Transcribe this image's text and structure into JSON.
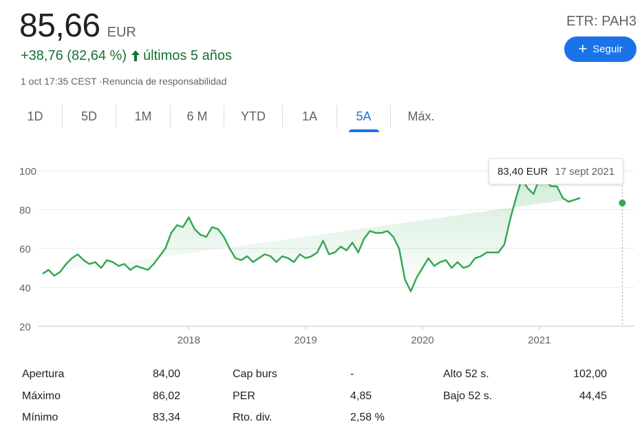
{
  "header": {
    "price": "85,66",
    "currency": "EUR",
    "change": "+38,76 (82,64 %)",
    "change_period": "últimos 5 años",
    "meta": "1 oct 17:35 CEST ·Renuncia de responsabilidad",
    "ticker": "ETR: PAH3",
    "follow_label": "Seguir"
  },
  "tabs": [
    {
      "label": "1D"
    },
    {
      "label": "5D"
    },
    {
      "label": "1M"
    },
    {
      "label": "6 M"
    },
    {
      "label": "YTD"
    },
    {
      "label": "1A"
    },
    {
      "label": "5A"
    },
    {
      "label": "Máx."
    }
  ],
  "active_tab": "5A",
  "tooltip": {
    "value": "83,40 EUR",
    "date": "17 sept 2021"
  },
  "stats": [
    {
      "label": "Apertura",
      "value": "84,00"
    },
    {
      "label": "Máximo",
      "value": "86,02"
    },
    {
      "label": "Mínimo",
      "value": "83,34"
    },
    {
      "label": "Cap burs",
      "value": "-"
    },
    {
      "label": "PER",
      "value": "4,85"
    },
    {
      "label": "Rto. div.",
      "value": "2,58 %"
    },
    {
      "label": "Alto 52 s.",
      "value": "102,00"
    },
    {
      "label": "Bajo 52 s.",
      "value": "44,45"
    }
  ],
  "colors": {
    "line": "#34a853",
    "accent": "#1a73e8",
    "positive": "#137333"
  },
  "chart_data": {
    "type": "area",
    "ylim": [
      20,
      100
    ],
    "y_ticks": [
      100,
      80,
      60,
      40,
      20
    ],
    "x_ticks": [
      "2018",
      "2019",
      "2020",
      "2021"
    ],
    "x_tick_positions": [
      2018.0,
      2019.0,
      2020.0,
      2021.0
    ],
    "xlim": [
      2016.75,
      2021.79
    ],
    "grid": true,
    "marker": {
      "x": 2021.71,
      "y": 83.4
    },
    "x": [
      2016.75,
      2016.8,
      2016.85,
      2016.9,
      2016.95,
      2017.0,
      2017.05,
      2017.1,
      2017.15,
      2017.2,
      2017.25,
      2017.3,
      2017.35,
      2017.4,
      2017.45,
      2017.5,
      2017.55,
      2017.6,
      2017.65,
      2017.7,
      2017.75,
      2017.8,
      2017.85,
      2017.9,
      2017.95,
      2018.0,
      2018.05,
      2018.1,
      2018.15,
      2018.2,
      2018.25,
      2018.3,
      2018.35,
      2018.4,
      2018.45,
      2018.5,
      2018.55,
      2018.6,
      2018.65,
      2018.7,
      2018.75,
      2018.8,
      2018.85,
      2018.9,
      2018.95,
      2019.0,
      2019.05,
      2019.1,
      2019.15,
      2019.2,
      2019.25,
      2019.3,
      2019.35,
      2019.4,
      2019.45,
      2019.5,
      2019.55,
      2019.6,
      2019.65,
      2019.7,
      2019.75,
      2019.8,
      2019.85,
      2019.9,
      2019.95,
      2020.0,
      2020.05,
      2020.1,
      2020.15,
      2020.2,
      2020.25,
      2020.3,
      2020.35,
      2020.4,
      2020.45,
      2020.5,
      2020.55,
      2020.6,
      2020.65,
      2020.7,
      2020.75,
      2020.8,
      2020.85,
      2020.9,
      2020.95,
      2021.0,
      2021.05,
      2021.1,
      2021.15,
      2021.2,
      2021.25,
      2021.3,
      2021.35,
      2021.4,
      2021.45,
      2021.5,
      2021.55,
      2021.6,
      2021.65,
      2021.7,
      2021.75,
      2021.79
    ],
    "y": [
      47,
      49,
      46,
      48,
      52,
      55,
      57,
      54,
      52,
      53,
      50,
      54,
      53,
      51,
      52,
      49,
      51,
      50,
      49,
      52,
      56,
      60,
      68,
      72,
      71,
      76,
      70,
      67,
      66,
      71,
      70,
      66,
      60,
      55,
      54,
      56,
      53,
      55,
      57,
      56,
      53,
      56,
      55,
      53,
      57,
      55,
      56,
      58,
      64,
      57,
      58,
      61,
      59,
      63,
      58,
      65,
      69,
      68,
      68,
      69,
      66,
      60,
      44,
      38,
      45,
      50,
      55,
      51,
      53,
      54,
      50,
      53,
      50,
      51,
      55,
      56,
      58,
      58,
      58,
      62,
      75,
      86,
      96,
      91,
      88,
      96,
      95,
      92,
      92,
      86,
      84,
      85,
      86
    ]
  }
}
